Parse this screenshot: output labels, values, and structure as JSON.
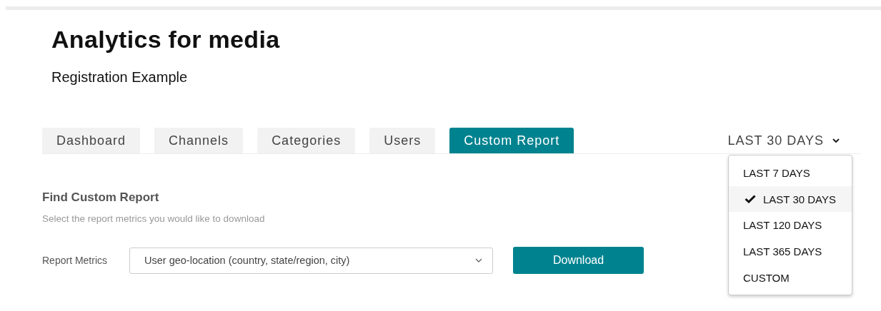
{
  "header": {
    "title": "Analytics for media",
    "subtitle": "Registration Example"
  },
  "tabs": [
    {
      "label": "Dashboard",
      "selected": false
    },
    {
      "label": "Channels",
      "selected": false
    },
    {
      "label": "Categories",
      "selected": false
    },
    {
      "label": "Users",
      "selected": false
    },
    {
      "label": "Custom Report",
      "selected": true
    }
  ],
  "period": {
    "label": "LAST 30 DAYS",
    "expanded": true,
    "options": [
      {
        "label": "LAST 7 DAYS",
        "selected": false
      },
      {
        "label": "LAST 30 DAYS",
        "selected": true
      },
      {
        "label": "LAST 120 DAYS",
        "selected": false
      },
      {
        "label": "LAST 365 DAYS",
        "selected": false
      },
      {
        "label": "CUSTOM",
        "selected": false
      }
    ]
  },
  "section": {
    "heading": "Find Custom Report",
    "description": "Select the report metrics you would like to download",
    "field_label": "Report Metrics",
    "field_value": "User geo-location (country, state/region, city)",
    "button": "Download"
  }
}
